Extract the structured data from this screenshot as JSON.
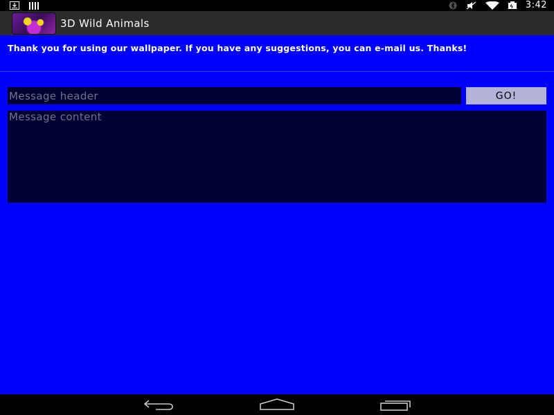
{
  "status_bar": {
    "time": "3:42",
    "icons_left": [
      "download-icon",
      "signal-bars-icon"
    ],
    "icons_right": [
      "bluetooth-icon",
      "mute-icon",
      "wifi-icon",
      "battery-icon"
    ]
  },
  "action_bar": {
    "title": "3D Wild Animals",
    "icon": "app-icon"
  },
  "content": {
    "info_text": "Thank you for using our wallpaper. If you have any suggestions, you can e-mail us. Thanks!",
    "header_placeholder": "Message header",
    "header_value": "",
    "go_label": "GO!",
    "content_placeholder": "Message content",
    "content_value": ""
  },
  "nav_bar": {
    "buttons": [
      "back-icon",
      "home-icon",
      "recents-icon"
    ]
  },
  "colors": {
    "background": "#0000ff",
    "action_bar": "#2b2b2b",
    "input_bg": "#000033",
    "button_bg": "#b3b3d9"
  }
}
